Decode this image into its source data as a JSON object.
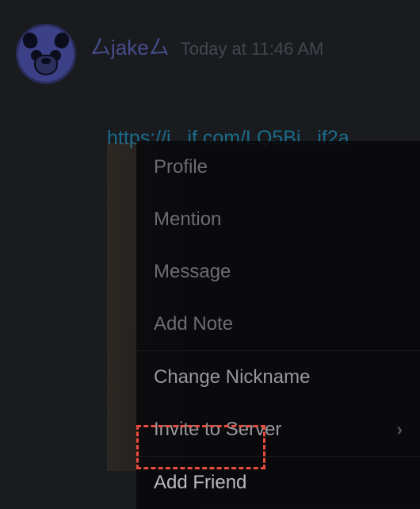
{
  "message": {
    "username": "厶jake厶",
    "timestamp": "Today at 11:46 AM",
    "link_partial": "https://i...if.com/LQ5Bi...if2a"
  },
  "context_menu": {
    "items": [
      {
        "label": "Profile"
      },
      {
        "label": "Mention"
      },
      {
        "label": "Message"
      },
      {
        "label": "Add Note"
      },
      {
        "label": "Change Nickname"
      },
      {
        "label": "Invite to Server",
        "has_submenu": true
      },
      {
        "label": "Add Friend"
      }
    ]
  }
}
